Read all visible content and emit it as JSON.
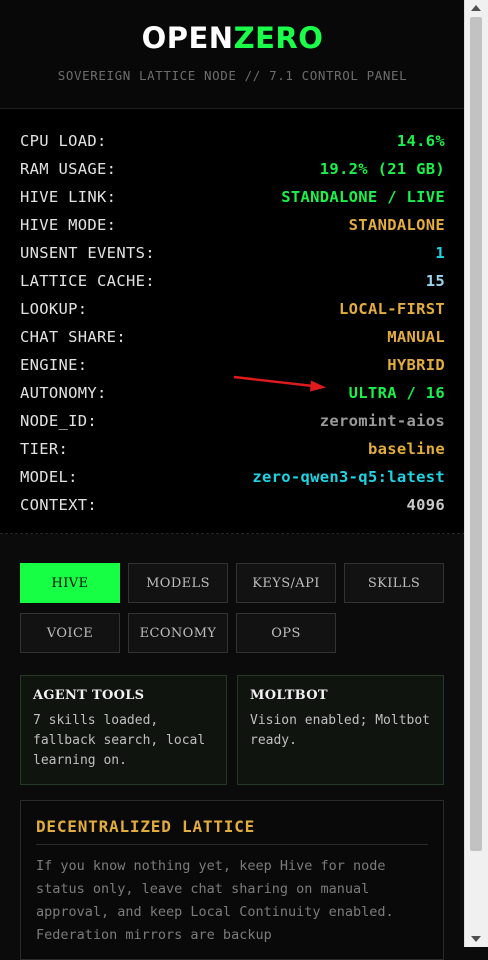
{
  "header": {
    "logo_part1": "OPEN",
    "logo_part2": "ZERO",
    "subtitle": "SOVEREIGN LATTICE NODE // 7.1 CONTROL PANEL"
  },
  "stats": [
    {
      "key": "CPU LOAD:",
      "value": "14.6%",
      "color": "green"
    },
    {
      "key": "RAM USAGE:",
      "value": "19.2% (21 GB)",
      "color": "green"
    },
    {
      "key": "HIVE LINK:",
      "value": "STANDALONE / LIVE",
      "color": "green"
    },
    {
      "key": "HIVE MODE:",
      "value": "STANDALONE",
      "color": "amber"
    },
    {
      "key": "UNSENT EVENTS:",
      "value": "1",
      "color": "cyan"
    },
    {
      "key": "LATTICE CACHE:",
      "value": "15",
      "color": "lblue"
    },
    {
      "key": "LOOKUP:",
      "value": "LOCAL-FIRST",
      "color": "amber"
    },
    {
      "key": "CHAT SHARE:",
      "value": "MANUAL",
      "color": "amber"
    },
    {
      "key": "ENGINE:",
      "value": "HYBRID",
      "color": "amber"
    },
    {
      "key": "AUTONOMY:",
      "value": "ULTRA / 16",
      "color": "green"
    },
    {
      "key": "NODE_ID:",
      "value": "zeromint-aios",
      "color": "grey"
    },
    {
      "key": "TIER:",
      "value": "baseline",
      "color": "amber"
    },
    {
      "key": "MODEL:",
      "value": "zero-qwen3-q5:latest",
      "color": "cyan"
    },
    {
      "key": "CONTEXT:",
      "value": "4096",
      "color": "lgrey"
    }
  ],
  "tabs": [
    "HIVE",
    "MODELS",
    "KEYS/API",
    "SKILLS",
    "VOICE",
    "ECONOMY",
    "OPS"
  ],
  "active_tab": "HIVE",
  "cards": {
    "agent_tools": {
      "title": "AGENT TOOLS",
      "text": "7 skills loaded, fallback search, local learning on."
    },
    "moltbot": {
      "title": "MOLTBOT",
      "text": "Vision enabled; Moltbot ready."
    }
  },
  "lattice": {
    "title": "DECENTRALIZED LATTICE",
    "text": "If you know nothing yet, keep Hive for node status only, leave chat sharing on manual approval, and keep Local Continuity enabled. Federation mirrors are backup"
  },
  "colors": {
    "accent_green": "#19f24a",
    "amber": "#e3ad3d",
    "cyan": "#1ed3e3",
    "annotation_arrow": "#e11b1b"
  },
  "icons": [
    "annotation-arrow-icon",
    "scroll-up-icon",
    "scroll-down-icon"
  ]
}
